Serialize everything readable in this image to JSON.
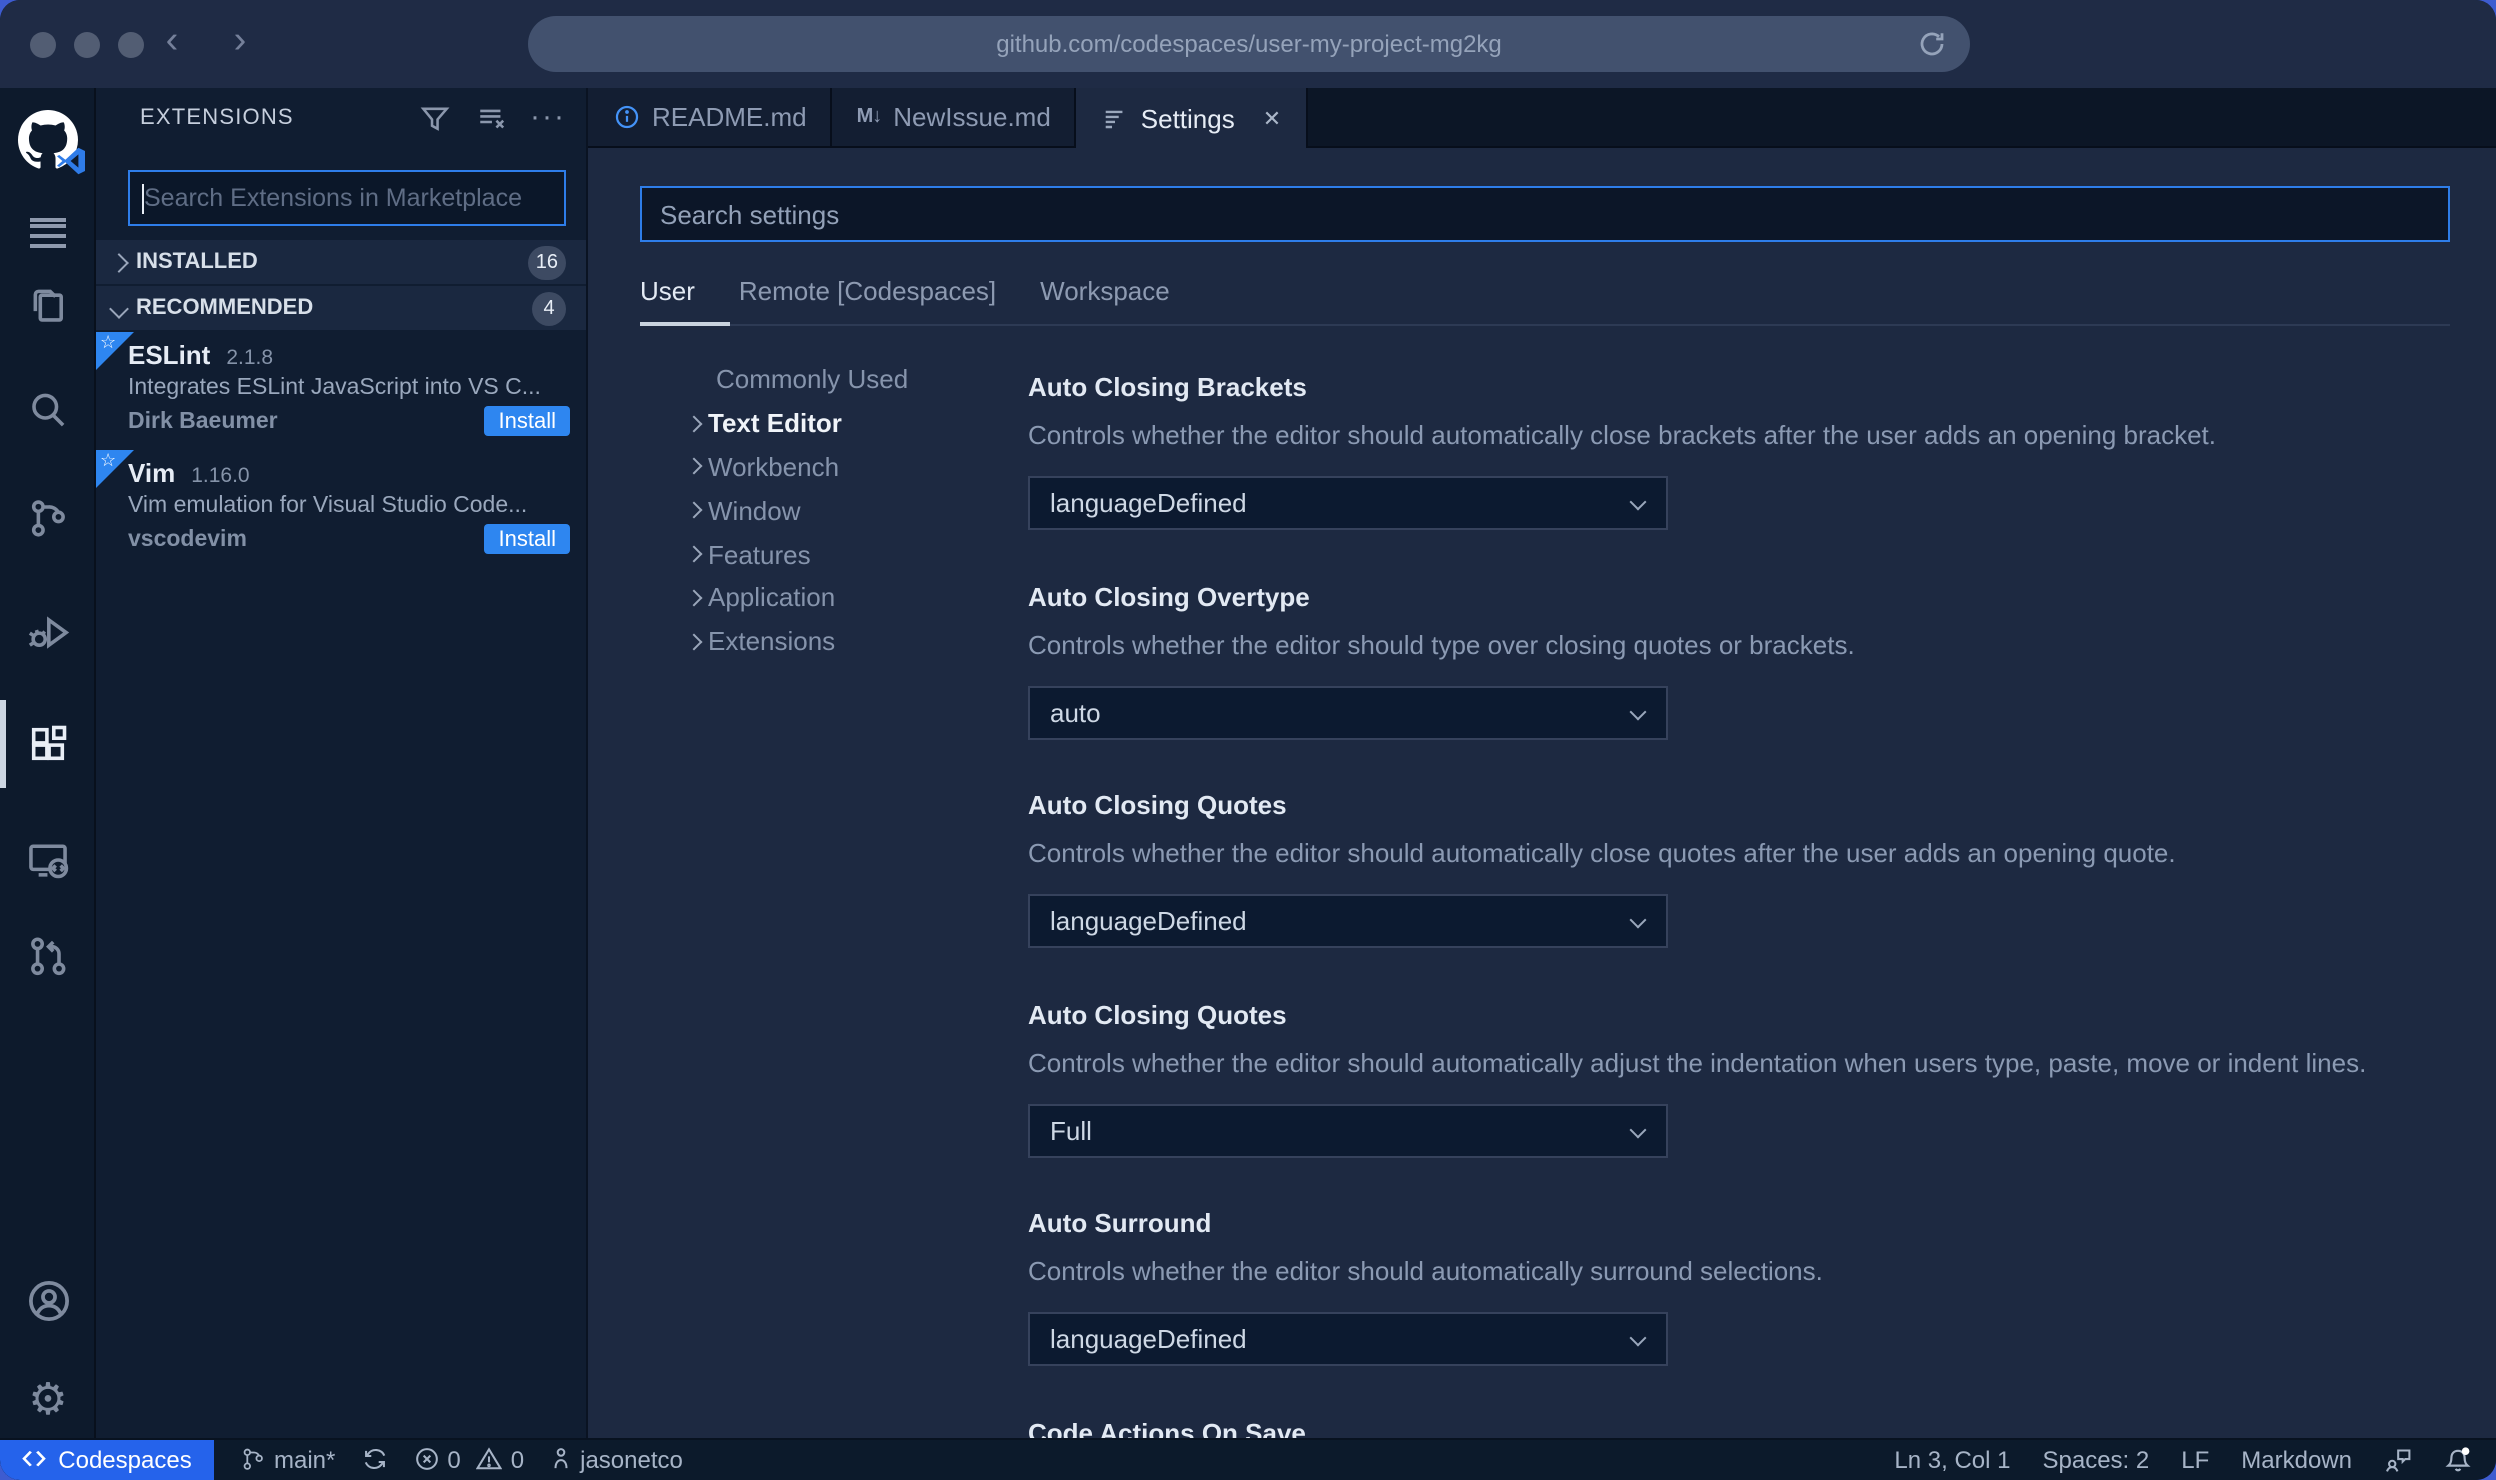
{
  "browser": {
    "url": "github.com/codespaces/user-my-project-mg2kg"
  },
  "activity_bar": {
    "icons": [
      "codespaces-logo",
      "menu",
      "explorer",
      "search",
      "source-control",
      "run-and-debug",
      "extensions",
      "remote-explorer",
      "github-pull-requests",
      "account",
      "settings-gear"
    ],
    "active": "extensions"
  },
  "sidebar": {
    "title": "EXTENSIONS",
    "search_placeholder": "Search Extensions in Marketplace",
    "sections": [
      {
        "label": "INSTALLED",
        "count": "16"
      },
      {
        "label": "RECOMMENDED",
        "count": "4"
      }
    ],
    "extensions": [
      {
        "name": "ESLint",
        "version": "2.1.8",
        "description": "Integrates ESLint JavaScript into VS C...",
        "publisher": "Dirk Baeumer",
        "action": "Install"
      },
      {
        "name": "Vim",
        "version": "1.16.0",
        "description": "Vim emulation for Visual Studio Code...",
        "publisher": "vscodevim",
        "action": "Install"
      }
    ]
  },
  "tabs": [
    {
      "label": "README.md"
    },
    {
      "label": "NewIssue.md",
      "icon_glyph": "M↓"
    },
    {
      "label": "Settings",
      "close_glyph": "✕"
    }
  ],
  "settings": {
    "search_placeholder": "Search settings",
    "scopes": [
      {
        "label": "User"
      },
      {
        "label": "Remote [Codespaces]"
      },
      {
        "label": "Workspace"
      }
    ],
    "toc": [
      {
        "label": "Commonly Used"
      },
      {
        "label": "Text Editor"
      },
      {
        "label": "Workbench"
      },
      {
        "label": "Window"
      },
      {
        "label": "Features"
      },
      {
        "label": "Application"
      },
      {
        "label": "Extensions"
      }
    ],
    "items": [
      {
        "title": "Auto Closing Brackets",
        "description": "Controls whether the editor should automatically close brackets after the user adds an opening bracket.",
        "value": "languageDefined"
      },
      {
        "title": "Auto Closing Overtype",
        "description": "Controls whether the editor should type over closing quotes or brackets.",
        "value": "auto"
      },
      {
        "title": "Auto Closing Quotes",
        "description": "Controls whether the editor should automatically close quotes after the user adds an opening quote.",
        "value": "languageDefined"
      },
      {
        "title": "Auto Closing Quotes",
        "description": "Controls whether the editor should automatically adjust the indentation when users type, paste, move or indent lines.",
        "value": "Full"
      },
      {
        "title": "Auto Surround",
        "description": "Controls whether the editor should automatically surround selections.",
        "value": "languageDefined"
      },
      {
        "title": "Code Actions On Save"
      }
    ]
  },
  "status_bar": {
    "codespaces_label": "Codespaces",
    "branch": "main*",
    "errors": "0",
    "warnings": "0",
    "user": "jasonetco",
    "cursor": "Ln 3, Col 1",
    "indent": "Spaces: 2",
    "eol": "LF",
    "language": "Markdown"
  },
  "colors": {
    "desktop_background": "#3e5cd0",
    "accent_blue": "#2e86f0",
    "focus_border": "#2e7de9",
    "status_badge_blue": "#2563eb",
    "tab_info_icon_blue": "#4493f8"
  }
}
